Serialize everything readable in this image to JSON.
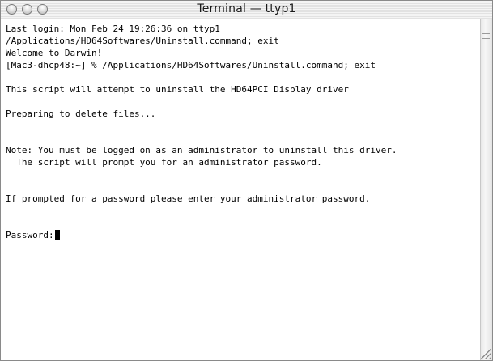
{
  "window": {
    "title": "Terminal — ttyp1"
  },
  "terminal": {
    "lines": [
      "Last login: Mon Feb 24 19:26:36 on ttyp1",
      "/Applications/HD64Softwares/Uninstall.command; exit",
      "Welcome to Darwin!",
      "[Mac3-dhcp48:~] % /Applications/HD64Softwares/Uninstall.command; exit",
      "",
      "This script will attempt to uninstall the HD64PCI Display driver",
      "",
      "Preparing to delete files...",
      "",
      "",
      "Note: You must be logged on as an administrator to uninstall this driver.",
      "  The script will prompt you for an administrator password.",
      "",
      "",
      "If prompted for a password please enter your administrator password.",
      "",
      "",
      "Password:"
    ]
  },
  "icons": {
    "close": "close-icon",
    "minimize": "minimize-icon",
    "zoom": "zoom-icon",
    "resize": "resize-grip-icon"
  }
}
